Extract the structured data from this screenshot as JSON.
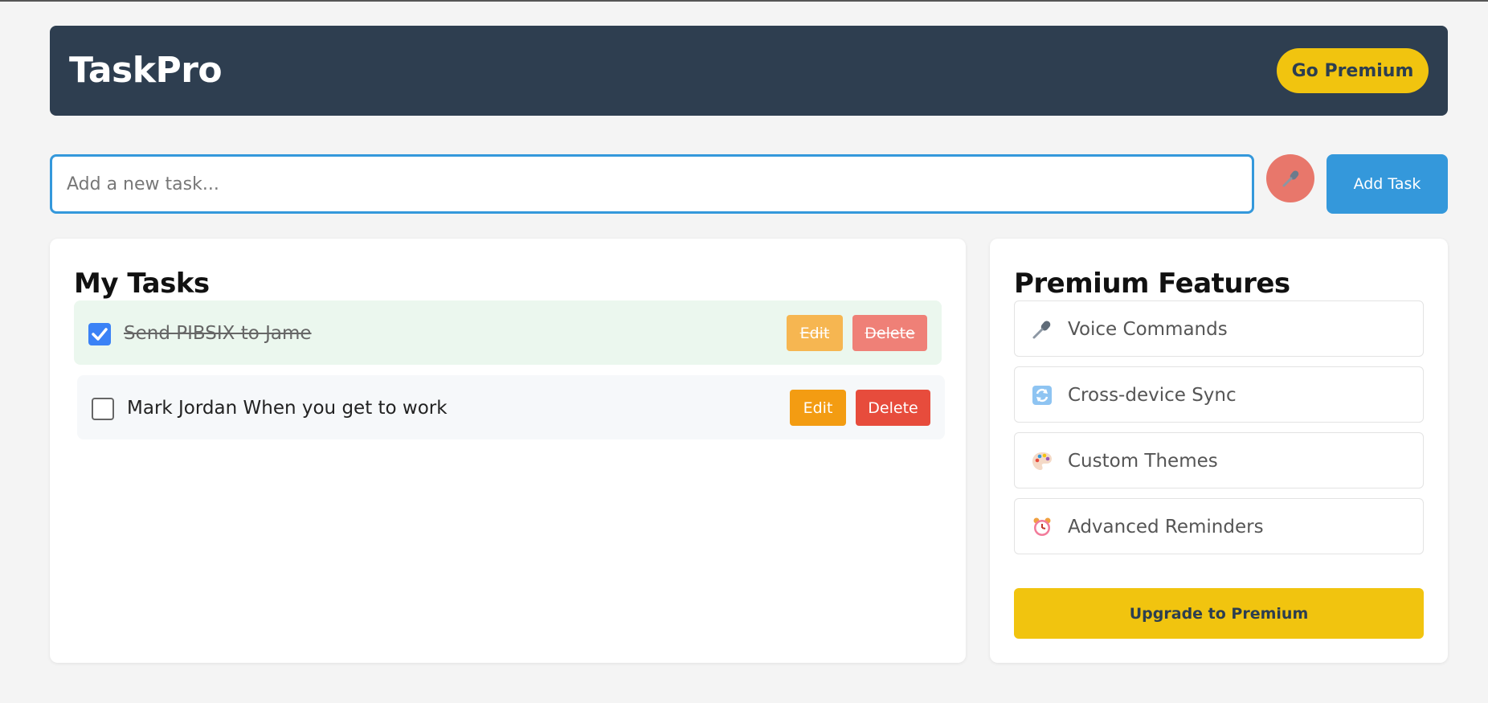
{
  "header": {
    "brand": "TaskPro",
    "go_premium_label": "Go Premium"
  },
  "input": {
    "placeholder": "Add a new task...",
    "value": ""
  },
  "mic_icon": "microphone-icon",
  "add_task_label": "Add Task",
  "tasks_panel": {
    "title": "My Tasks",
    "tasks": [
      {
        "text": "Send PIBSIX to Jame",
        "completed": true,
        "edit_label": "Edit",
        "delete_label": "Delete"
      },
      {
        "text": "Mark Jordan When you get to work",
        "completed": false,
        "edit_label": "Edit",
        "delete_label": "Delete"
      }
    ]
  },
  "premium_panel": {
    "title": "Premium Features",
    "features": [
      {
        "label": "Voice Commands",
        "icon": "microphone-icon"
      },
      {
        "label": "Cross-device Sync",
        "icon": "sync-icon"
      },
      {
        "label": "Custom Themes",
        "icon": "palette-icon"
      },
      {
        "label": "Advanced Reminders",
        "icon": "alarm-clock-icon"
      }
    ],
    "upgrade_label": "Upgrade to Premium"
  },
  "colors": {
    "header_bg": "#2e3e50",
    "accent_yellow": "#f1c40f",
    "accent_blue": "#3498db",
    "edit_orange": "#f39c12",
    "delete_red": "#e74c3c"
  }
}
